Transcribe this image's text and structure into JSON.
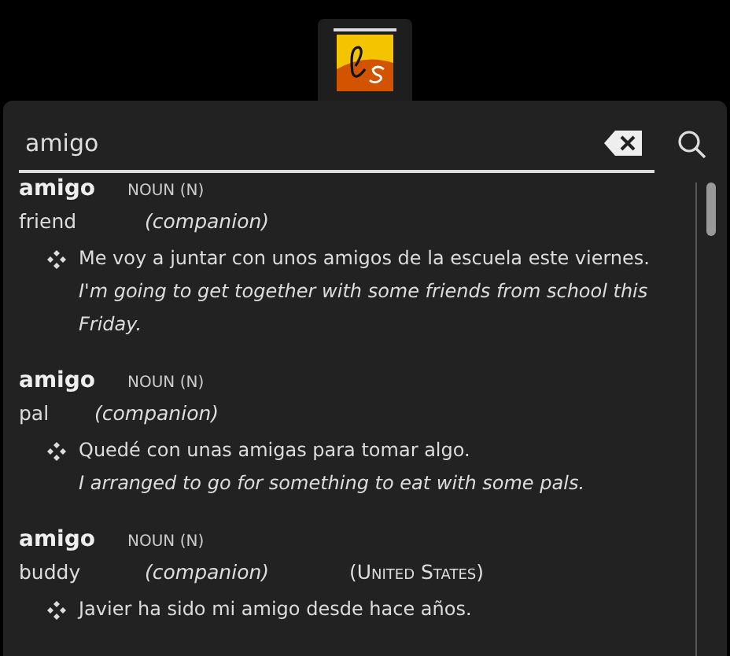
{
  "search": {
    "value": "amigo"
  },
  "entries": [
    {
      "headword": "amigo",
      "pos": "NOUN (N)",
      "translation": "friend",
      "sense": "(companion)",
      "examples": [
        {
          "es": "Me voy a juntar con unos amigos de la escuela este viernes.",
          "en": "I'm going to get together with some friends from school this Friday."
        }
      ]
    },
    {
      "headword": "amigo",
      "pos": "NOUN (N)",
      "translation": "pal",
      "sense": "(companion)",
      "examples": [
        {
          "es": "Quedé con unas amigas para tomar algo.",
          "en": "I arranged to go for something to eat with some pals."
        }
      ]
    },
    {
      "headword": "amigo",
      "pos": "NOUN (N)",
      "translation": "buddy",
      "sense": "(companion)",
      "region": "(United States)",
      "examples": [
        {
          "es": "Javier ha sido mi amigo desde hace años."
        }
      ]
    }
  ]
}
